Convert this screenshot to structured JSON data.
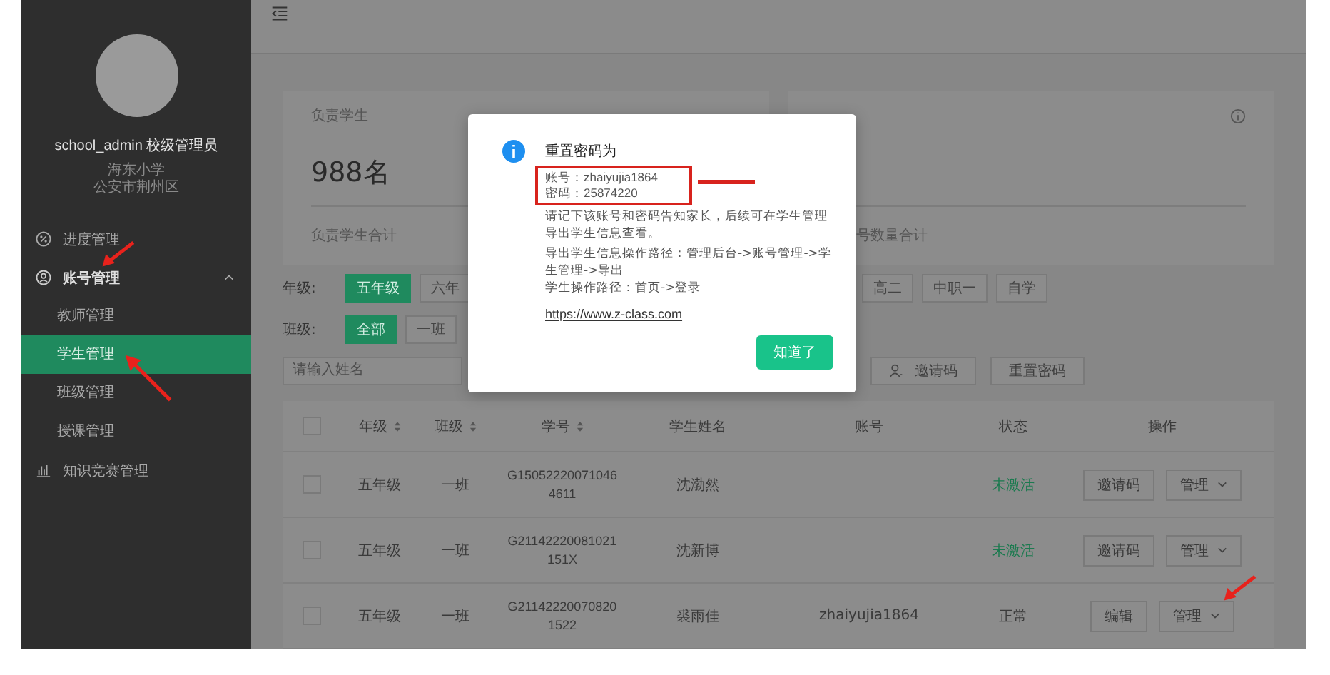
{
  "sidebar": {
    "user": {
      "name": "school_admin 校级管理员",
      "school": "海东小学",
      "district": "公安市荆州区"
    },
    "menu": [
      {
        "label": "进度管理",
        "kind": "link"
      },
      {
        "label": "账号管理",
        "kind": "group",
        "expanded": true,
        "children": [
          {
            "label": "教师管理",
            "selected": false
          },
          {
            "label": "学生管理",
            "selected": true
          },
          {
            "label": "班级管理",
            "selected": false
          },
          {
            "label": "授课管理",
            "selected": false
          }
        ]
      },
      {
        "label": "知识竞赛管理",
        "kind": "link"
      }
    ]
  },
  "stats": [
    {
      "title": "负责学生",
      "value": "988名",
      "footer": "负责学生合计"
    },
    {
      "footer": "号数量合计"
    }
  ],
  "filters": [
    {
      "label": "年级:",
      "options": [
        {
          "label": "五年级",
          "selected": true
        },
        {
          "label": "六年",
          "selected": false
        },
        {
          "label": "高二",
          "selected": false
        },
        {
          "label": "中职一",
          "selected": false
        },
        {
          "label": "自学",
          "selected": false
        }
      ]
    },
    {
      "label": "班级:",
      "options": [
        {
          "label": "全部",
          "selected": true
        },
        {
          "label": "一班",
          "selected": false
        }
      ]
    }
  ],
  "search": {
    "placeholder": "请输入姓名"
  },
  "actions": [
    "邀请码",
    "重置密码"
  ],
  "table": {
    "all_checked": false,
    "columns": [
      {
        "label": "年级",
        "sortable": true
      },
      {
        "label": "班级",
        "sortable": true
      },
      {
        "label": "学号",
        "sortable": true
      },
      {
        "label": "学生姓名",
        "sortable": false
      },
      {
        "label": "账号",
        "sortable": false
      },
      {
        "label": "状态",
        "sortable": false
      },
      {
        "label": "操作",
        "sortable": false
      }
    ],
    "rows": [
      {
        "checked": false,
        "grade": "五年级",
        "class": "一班",
        "id": "G150522200710464611",
        "name": "沈渤然",
        "account": "",
        "status": {
          "text": "未激活",
          "color": "#1b7a4f"
        },
        "action": "邀请码",
        "menu": "管理"
      },
      {
        "checked": false,
        "grade": "五年级",
        "class": "一班",
        "id": "G21142220081021151X",
        "name": "沈新博",
        "account": "",
        "status": {
          "text": "未激活",
          "color": "#1b7a4f"
        },
        "action": "邀请码",
        "menu": "管理"
      },
      {
        "checked": false,
        "grade": "五年级",
        "class": "一班",
        "id": "G211422200708201522",
        "name": "裘雨佳",
        "account": "zhaiyujia1864",
        "status": {
          "text": "正常",
          "color": "#3a3a3a"
        },
        "action": "编辑",
        "menu": "管理"
      }
    ]
  },
  "dialog": {
    "title": "重置密码为",
    "account": "账号：zhaiyujia1864",
    "password": "密码：25874220",
    "message": "请记下该账号和密码告知家长，后续可在学生管理导出学生信息查看。",
    "export_path": "导出学生信息操作路径：管理后台->账号管理->学生管理->导出",
    "student_path": "学生操作路径：首页->登录",
    "link": "https://www.z-class.com",
    "button": "知道了"
  }
}
